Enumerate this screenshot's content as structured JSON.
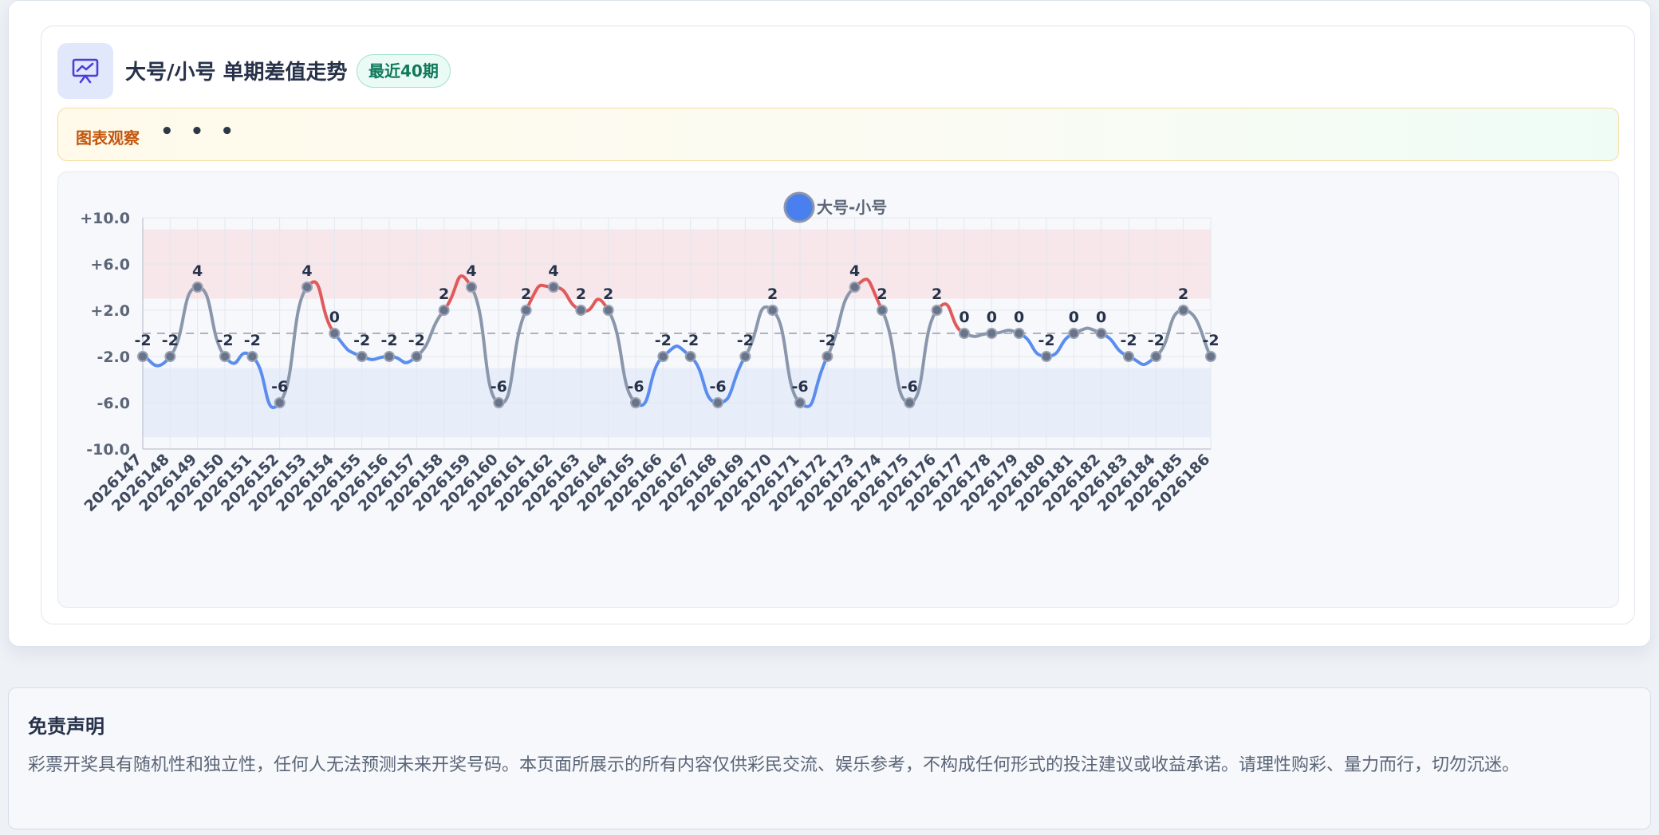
{
  "header": {
    "title": "大号/小号 单期差值走势",
    "badge": "最近40期",
    "icon": "presentation-chart-icon"
  },
  "observation": {
    "label": "图表观察",
    "dots": "• • •"
  },
  "colors": {
    "positive": "#e05a5a",
    "negative": "#5b8def",
    "neutral": "#8a97ab",
    "legend_dot": "#4a7ff0"
  },
  "chart_data": {
    "type": "line",
    "legend": [
      "大号-小号"
    ],
    "x": [
      "2026147",
      "2026148",
      "2026149",
      "2026150",
      "2026151",
      "2026152",
      "2026153",
      "2026154",
      "2026155",
      "2026156",
      "2026157",
      "2026158",
      "2026159",
      "2026160",
      "2026161",
      "2026162",
      "2026163",
      "2026164",
      "2026165",
      "2026166",
      "2026167",
      "2026168",
      "2026169",
      "2026170",
      "2026171",
      "2026172",
      "2026173",
      "2026174",
      "2026175",
      "2026176",
      "2026177",
      "2026178",
      "2026179",
      "2026180",
      "2026181",
      "2026182",
      "2026183",
      "2026184",
      "2026185",
      "2026186"
    ],
    "series": [
      {
        "name": "大号-小号",
        "values": [
          -2,
          -2,
          4,
          -2,
          -2,
          -6,
          4,
          0,
          -2,
          -2,
          -2,
          2,
          4,
          -6,
          2,
          4,
          2,
          2,
          -6,
          -2,
          -2,
          -6,
          -2,
          2,
          -6,
          -2,
          4,
          2,
          -6,
          2,
          0,
          0,
          0,
          -2,
          0,
          0,
          -2,
          -2,
          2,
          -2
        ]
      }
    ],
    "ylim": [
      -10,
      10
    ],
    "yticks": [
      "+10.0",
      "+6.0",
      "+2.0",
      "-2.0",
      "-6.0",
      "-10.0"
    ],
    "bands": [
      {
        "from": 3,
        "to": 9,
        "color": "#f7e6ea"
      },
      {
        "from": -9,
        "to": -3,
        "color": "#e7eefa"
      }
    ],
    "reference_line": 0,
    "grid": true,
    "legend_position": "top-center"
  },
  "disclaimer": {
    "title": "免责声明",
    "text": "彩票开奖具有随机性和独立性，任何人无法预测未来开奖号码。本页面所展示的所有内容仅供彩民交流、娱乐参考，不构成任何形式的投注建议或收益承诺。请理性购彩、量力而行，切勿沉迷。"
  }
}
